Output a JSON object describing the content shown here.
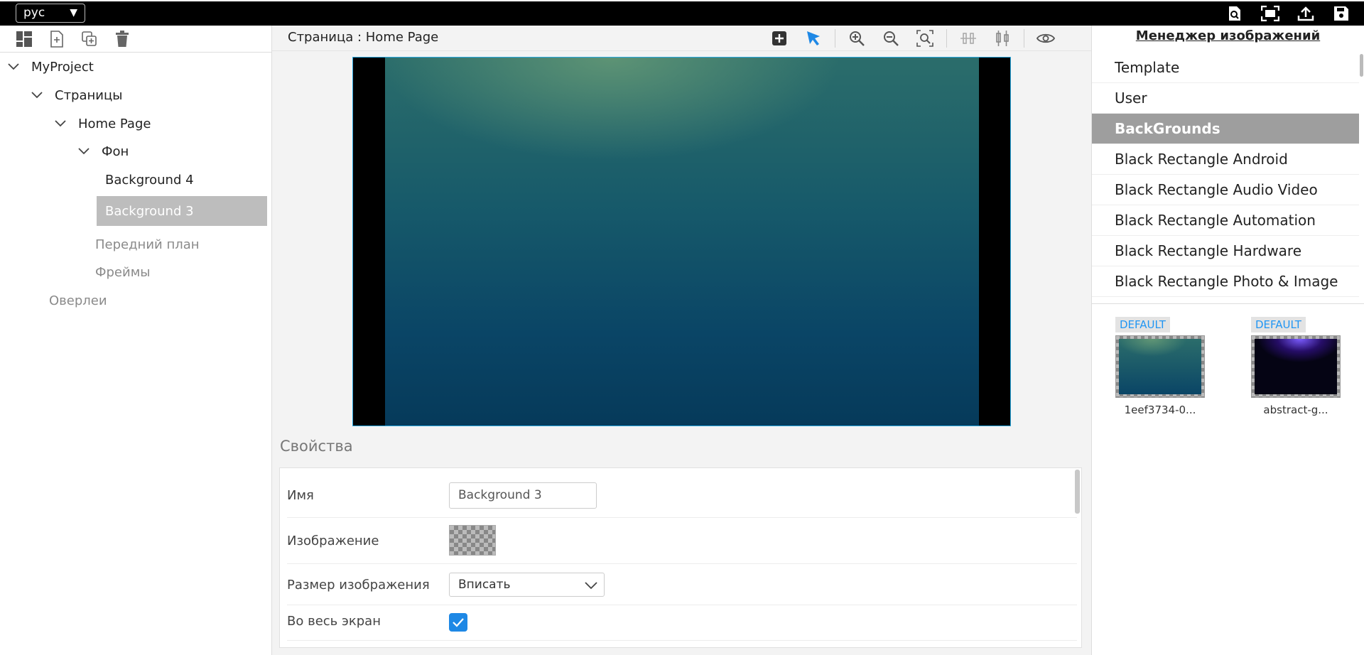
{
  "topbar": {
    "language": "рус",
    "icons": [
      "search-document-icon",
      "fullscreen-icon",
      "upload-icon",
      "save-icon"
    ]
  },
  "left_toolbar": {
    "icons": [
      "layout-icon",
      "new-page-icon",
      "duplicate-icon",
      "delete-icon"
    ]
  },
  "tree": {
    "project": "MyProject",
    "pages": "Страницы",
    "home_page": "Home Page",
    "background_group": "Фон",
    "bg4": "Background 4",
    "bg3": "Background 3",
    "foreground": "Передний план",
    "frames": "Фреймы",
    "overlays": "Оверлеи"
  },
  "center": {
    "page_title": "Страница : Home Page",
    "tools": [
      "add-icon",
      "pointer-icon",
      "zoom-in-icon",
      "zoom-out-icon",
      "zoom-fit-icon",
      "align-horizontal-icon",
      "align-vertical-icon",
      "preview-eye-icon"
    ]
  },
  "properties": {
    "title": "Свойства",
    "name_label": "Имя",
    "name_value": "Background 3",
    "image_label": "Изображение",
    "size_label": "Размер изображения",
    "size_value": "Вписать",
    "fullscreen_label": "Во весь экран",
    "fullscreen_checked": true
  },
  "image_manager": {
    "title": "Менеджер изображений",
    "categories": [
      "Template",
      "User",
      "BackGrounds",
      "Black Rectangle Android",
      "Black Rectangle Audio Video",
      "Black Rectangle Automation",
      "Black Rectangle Hardware",
      "Black Rectangle Photo & Image"
    ],
    "selected": "BackGrounds",
    "thumbnails": [
      {
        "badge": "DEFAULT",
        "name": "1eef3734-0..."
      },
      {
        "badge": "DEFAULT",
        "name": "abstract-g..."
      }
    ]
  },
  "colors": {
    "accent": "#1e88e5",
    "selected_gray": "#bdbdbd",
    "topbar": "#000000"
  }
}
